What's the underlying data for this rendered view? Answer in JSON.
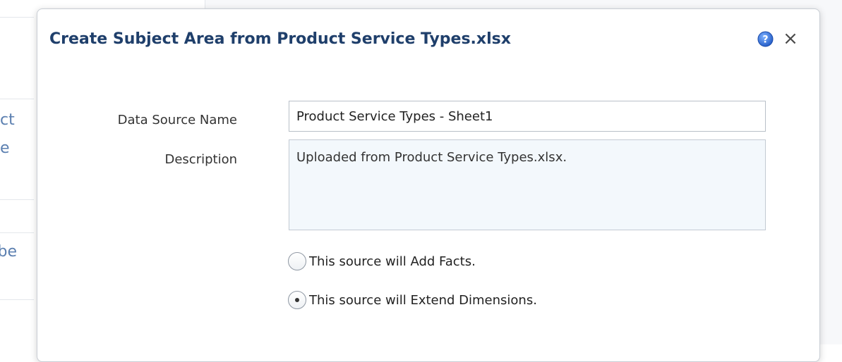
{
  "background": {
    "fragments": [
      "ct",
      "e",
      "be"
    ]
  },
  "dialog": {
    "title": "Create Subject Area from Product Service Types.xlsx",
    "help_icon": "help-icon",
    "close_icon": "close-icon",
    "close_glyph": "×"
  },
  "form": {
    "data_source_name_label": "Data Source Name",
    "data_source_name_value": "Product Service Types - Sheet1",
    "description_label": "Description",
    "description_value": "Uploaded from Product Service Types.xlsx.",
    "options": [
      {
        "label": "This source will Add Facts.",
        "selected": false
      },
      {
        "label": "This source will Extend Dimensions.",
        "selected": true
      }
    ]
  },
  "colors": {
    "title": "#1f3f6b",
    "description_bg": "#f3f8fc",
    "help_icon_blue": "#2f6bd0"
  }
}
